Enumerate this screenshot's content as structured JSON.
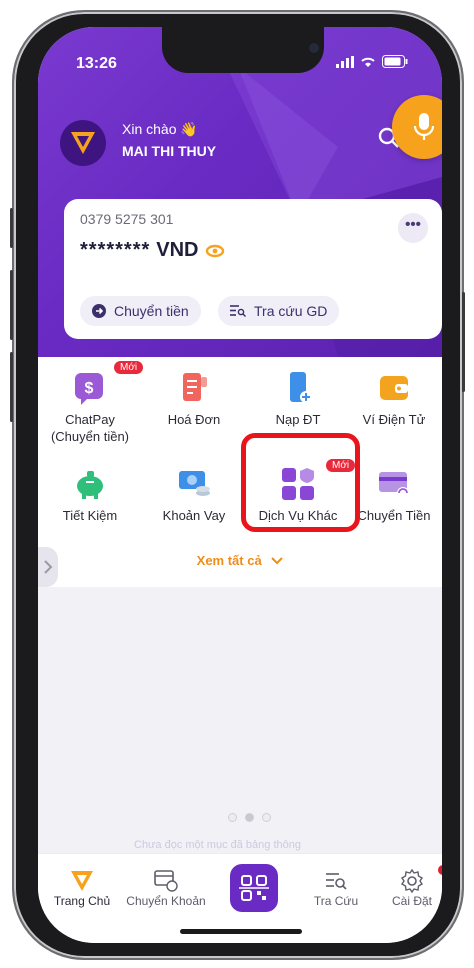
{
  "status": {
    "time": "13:26"
  },
  "greeting": {
    "hello": "Xin chào 👋",
    "name": "MAI THI THUY"
  },
  "account": {
    "number": "0379 5275 301",
    "masked_balance": "********",
    "currency": "VND",
    "more": "•••"
  },
  "quick_actions": [
    {
      "label": "Chuyển tiền",
      "icon": "arrow-right-circle-icon"
    },
    {
      "label": "Tra cứu GD",
      "icon": "search-list-icon"
    }
  ],
  "services": [
    {
      "label": "ChatPay\n(Chuyển tiền)",
      "icon": "chatpay-icon",
      "badge": "Mới",
      "color": "#9b59d6"
    },
    {
      "label": "Hoá Đơn",
      "icon": "bill-icon",
      "badge": "",
      "color": "#f0655d"
    },
    {
      "label": "Nạp ĐT",
      "icon": "phone-topup-icon",
      "badge": "",
      "color": "#3d8fe8"
    },
    {
      "label": "Ví Điện Tử",
      "icon": "wallet-icon",
      "badge": "",
      "color": "#f3a31e"
    },
    {
      "label": "Tiết Kiệm",
      "icon": "piggy-bank-icon",
      "badge": "",
      "color": "#2fbf7a"
    },
    {
      "label": "Khoản Vay",
      "icon": "loan-icon",
      "badge": "",
      "color": "#3d8fe8"
    },
    {
      "label": "Dịch Vụ Khác",
      "icon": "other-services-icon",
      "badge": "Mới",
      "color": "#8a47d6"
    },
    {
      "label": "Chuyển Tiền",
      "icon": "card-transfer-icon",
      "badge": "",
      "color": "#9b59d6"
    }
  ],
  "see_all": {
    "label": "Xem tất cả"
  },
  "footer_hint": "Chưa đọc một mục đã bảng thông",
  "tabs": [
    {
      "label": "Trang Chủ",
      "icon": "home-logo-icon",
      "active": true
    },
    {
      "label": "Chuyển Khoản",
      "icon": "transfer-icon",
      "active": false
    },
    {
      "label": "",
      "icon": "qr-scan-icon",
      "active": false
    },
    {
      "label": "Tra Cứu",
      "icon": "lookup-icon",
      "active": false
    },
    {
      "label": "Cài Đặt",
      "icon": "settings-icon",
      "active": false
    }
  ],
  "colors": {
    "brand": "#6a2bc4",
    "accent": "#f7a21c",
    "highlight": "#e8161c"
  }
}
